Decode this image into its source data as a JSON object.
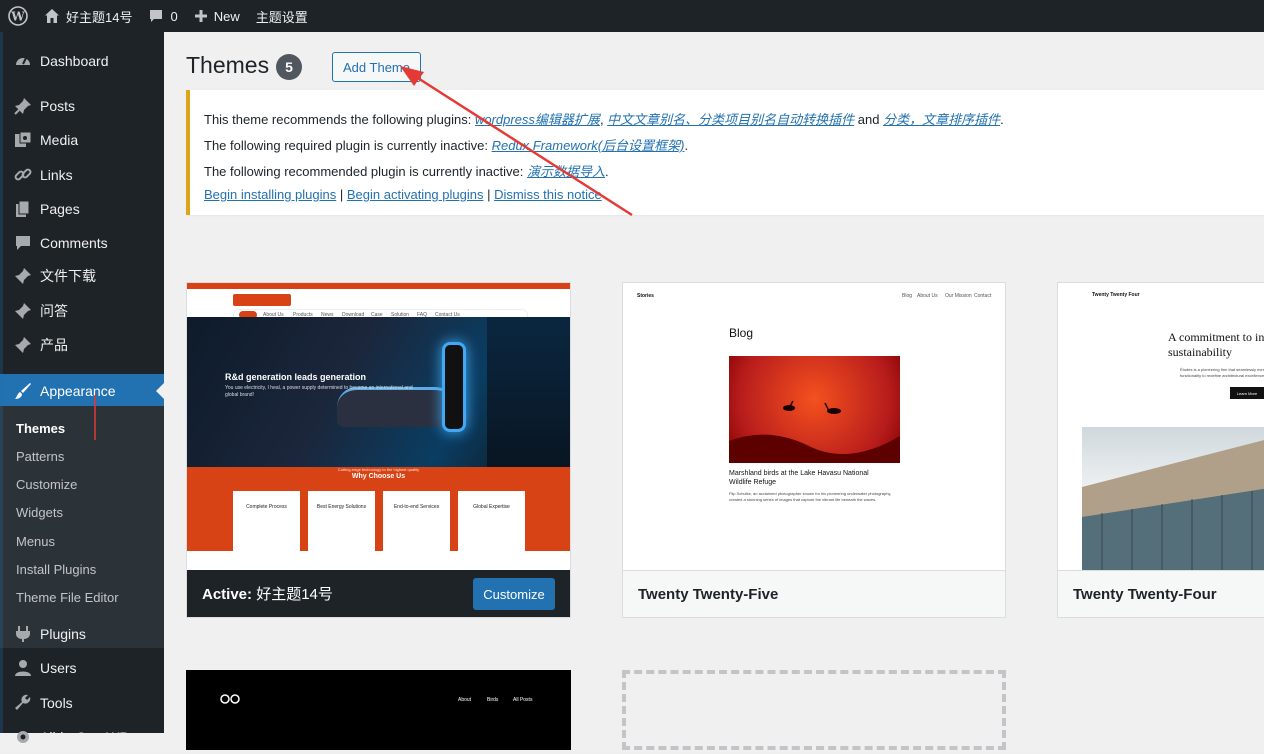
{
  "adminbar": {
    "site_name": "好主题14号",
    "comments_count": "0",
    "new_label": "New",
    "theme_settings": "主题设置"
  },
  "sidebar": {
    "items": [
      {
        "label": "Dashboard",
        "icon": "dashboard-icon"
      },
      {
        "label": "Posts",
        "icon": "pin-icon"
      },
      {
        "label": "Media",
        "icon": "media-icon"
      },
      {
        "label": "Links",
        "icon": "link-icon"
      },
      {
        "label": "Pages",
        "icon": "pages-icon"
      },
      {
        "label": "Comments",
        "icon": "comment-icon"
      },
      {
        "label": "文件下载",
        "icon": "pin-icon"
      },
      {
        "label": "问答",
        "icon": "pin-icon"
      },
      {
        "label": "产品",
        "icon": "pin-icon"
      },
      {
        "label": "Appearance",
        "icon": "brush-icon"
      },
      {
        "label": "Plugins",
        "icon": "plugin-icon"
      },
      {
        "label": "Users",
        "icon": "users-icon"
      },
      {
        "label": "Tools",
        "icon": "wrench-icon"
      },
      {
        "label": "All-in-One WP",
        "icon": "gear-icon"
      }
    ],
    "submenu": [
      "Themes",
      "Patterns",
      "Customize",
      "Widgets",
      "Menus",
      "Install Plugins",
      "Theme File Editor"
    ]
  },
  "header": {
    "title": "Themes",
    "count": "5",
    "add_button": "Add Theme"
  },
  "notice": {
    "line1_prefix": "This theme recommends the following plugins: ",
    "line1_link1": "wordpress编辑器扩展",
    "line1_sep1": ", ",
    "line1_link2": "中文文章别名、分类项目别名自动转换插件",
    "line1_and": " and ",
    "line1_link3": "分类，文章排序插件",
    "line1_end": ".",
    "line2_prefix": "The following required plugin is currently inactive: ",
    "line2_link": "Redux Framework(后台设置框架)",
    "line2_end": ".",
    "line3_prefix": "The following recommended plugin is currently inactive: ",
    "line3_link": "演示数据导入",
    "line3_end": ".",
    "action1": "Begin installing plugins",
    "sep": " | ",
    "action2": "Begin activating plugins",
    "action3": "Dismiss this notice"
  },
  "themes": [
    {
      "name": "好主题14号",
      "active_prefix": "Active:",
      "customize": "Customize",
      "preview": {
        "hero_title": "R&d generation leads generation",
        "hero_text": "You use electricity, I heal, a power supply determined to become an international and global brand!",
        "nav": [
          "Home",
          "About Us",
          "Products",
          "News",
          "Download",
          "Case",
          "Solution",
          "FAQ",
          "Contact Us"
        ],
        "section_sub": "Cutting-edge technology to the highest quality",
        "section_title": "Why Choose Us",
        "features": [
          "Complete Process",
          "Best Energy Solutions",
          "End-to-end Services",
          "Global Expertise"
        ]
      }
    },
    {
      "name": "Twenty Twenty-Five",
      "preview": {
        "site": "Stories",
        "nav": [
          "Blog",
          "About Us",
          "Our Mission",
          "Contact"
        ],
        "heading": "Blog",
        "post_title": "Marshland birds at the Lake Havasu National Wildlife Refuge",
        "post_text": "Flip Schulke, an acclaimed photographer known for his pioneering underwater photography, created a stunning series of images that capture the vibrant life beneath the waves."
      }
    },
    {
      "name": "Twenty Twenty-Four",
      "preview": {
        "site": "Twenty Twenty Four",
        "headline": "A commitment to innovation and sustainability",
        "text": "Études is a pioneering firm that seamlessly merges creativity and functionality to redefine architectural excellence.",
        "button": "Learn More"
      }
    },
    {
      "name": "",
      "preview": {
        "nav": [
          "About",
          "Birds",
          "All Posts"
        ]
      }
    }
  ],
  "colors": {
    "accent": "#2271b1",
    "sidebar_bg": "#1d2327",
    "notice_border": "#dba617",
    "arrow": "#e53935"
  }
}
